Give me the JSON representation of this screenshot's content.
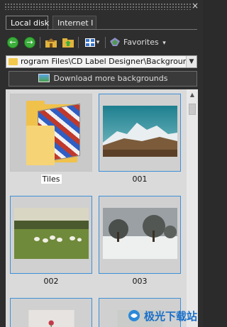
{
  "panel": {
    "close_glyph": "×"
  },
  "tabs": [
    {
      "label": "Local disk",
      "active": true
    },
    {
      "label": "Internet I",
      "active": false
    }
  ],
  "toolbar": {
    "back_icon": "arrow-left-icon",
    "forward_icon": "arrow-right-icon",
    "home_icon": "home-folder-icon",
    "up_icon": "folder-up-icon",
    "view_icon": "grid-view-icon",
    "favorites_label": "Favorites",
    "dropdown_glyph": "▾"
  },
  "path": {
    "value": "rogram Files\\CD Label Designer\\Backgrounds",
    "dropdown_glyph": "▼"
  },
  "download_button": {
    "label": "Download more backgrounds"
  },
  "thumbnails": [
    {
      "name": "Tiles",
      "kind": "folder",
      "selected": true
    },
    {
      "name": "001",
      "kind": "image",
      "selected": false
    },
    {
      "name": "002",
      "kind": "image",
      "selected": false
    },
    {
      "name": "003",
      "kind": "image",
      "selected": false
    }
  ],
  "watermark": {
    "text": "极光下载站"
  },
  "colors": {
    "panel_bg": "#2e2e2e",
    "grid_bg": "#dadada",
    "selection_border": "#3e8fd6",
    "accent_green": "#3cae3c"
  }
}
